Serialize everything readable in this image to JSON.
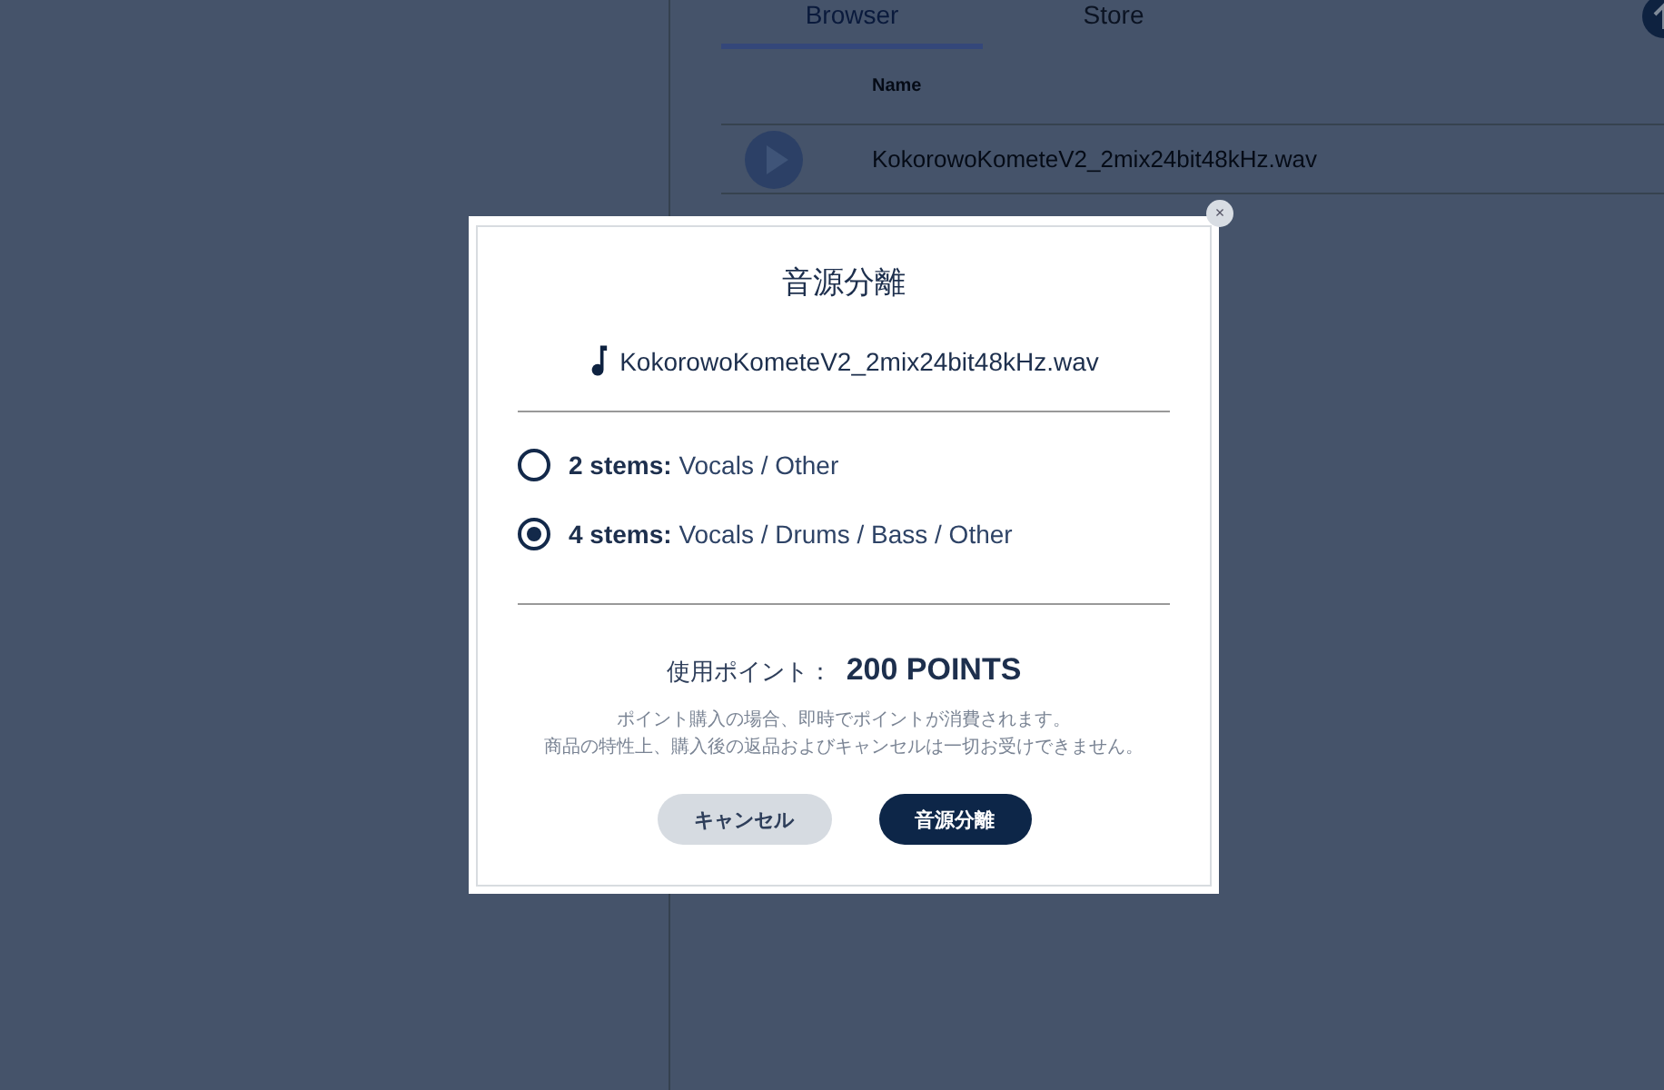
{
  "tabs": [
    {
      "label": "Browser",
      "selected": true
    },
    {
      "label": "Store",
      "selected": false
    }
  ],
  "table": {
    "columns": [
      "Name"
    ],
    "rows": [
      {
        "name": "KokorowoKometeV2_2mix24bit48kHz.wav"
      }
    ]
  },
  "dialog": {
    "title": "音源分離",
    "file_name": "KokorowoKometeV2_2mix24bit48kHz.wav",
    "options": [
      {
        "label": "**2 stems:** Vocals / Other",
        "selected": false
      },
      {
        "label": "**4 stems:** Vocals / Drums / Bass / Other",
        "selected": true
      }
    ],
    "points_label": "使用ポイント：",
    "points_value": "200 POINTS",
    "notice_lines": [
      "ポイント購入の場合、即時でポイントが消費されます。",
      "商品の特性上、購入後の返品およびキャンセルは一切お受けできません。"
    ],
    "close": "×",
    "buttons": [
      {
        "label": "キャンセル",
        "kind": "secondary"
      },
      {
        "label": "音源分離",
        "kind": "primary"
      }
    ]
  }
}
